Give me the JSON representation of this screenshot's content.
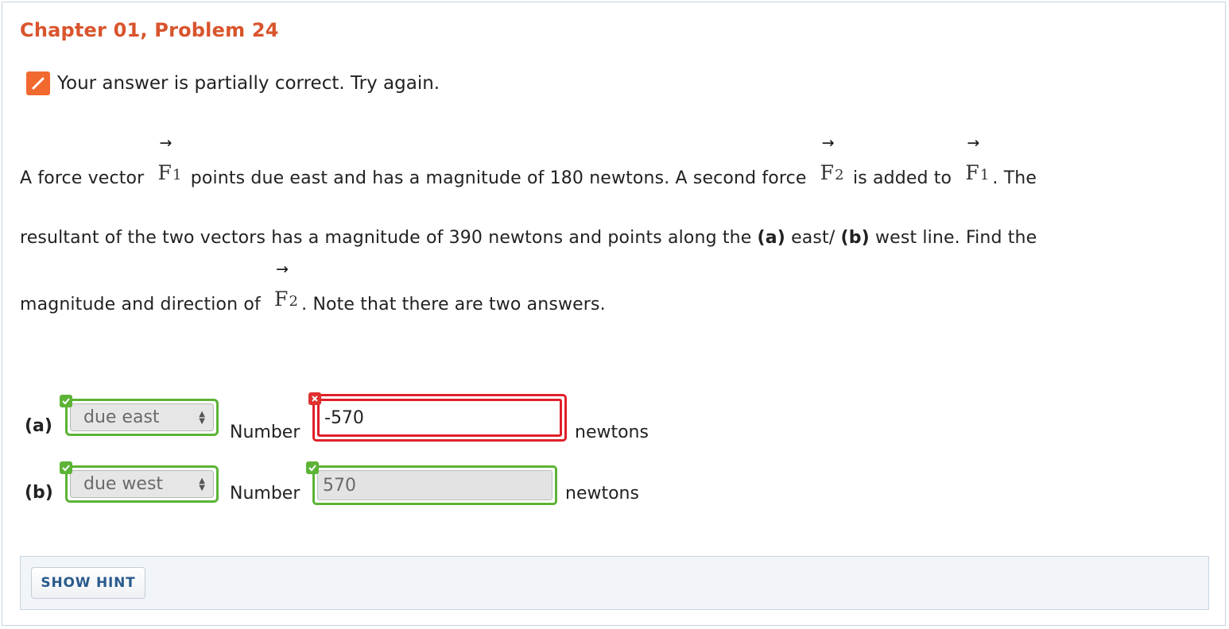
{
  "header": {
    "title": "Chapter 01, Problem 24"
  },
  "status": {
    "message": "Your answer is partially correct.  Try again.",
    "icon": "pencil-icon",
    "color": "#f2692f"
  },
  "problem": {
    "line1": {
      "a": "A force vector",
      "b": "points due east and has a magnitude of 180 newtons. A second force",
      "c": "is added to",
      "d": ". The"
    },
    "line2": {
      "a": "resultant of the two vectors has a magnitude of 390 newtons and points along the",
      "pa": "(a)",
      "b": "east/",
      "pb": "(b)",
      "c": "west line. Find the"
    },
    "line3": {
      "a": "magnitude and direction of",
      "b": ". Note that there are two answers."
    },
    "vectors": {
      "f1": "F",
      "f1_sub": "1",
      "f2": "F",
      "f2_sub": "2",
      "arrow": "→"
    }
  },
  "answers": {
    "a": {
      "label": "(a)",
      "direction": "due east",
      "number_label": "Number",
      "value": "-570",
      "unit": "newtons",
      "direction_status": "correct",
      "value_status": "incorrect"
    },
    "b": {
      "label": "(b)",
      "direction": "due west",
      "number_label": "Number",
      "value": "570",
      "unit": "newtons",
      "direction_status": "correct",
      "value_status": "correct"
    }
  },
  "colors": {
    "title": "#d9542c",
    "correct": "#5cb336",
    "incorrect": "#e0202a",
    "hint_text": "#2a5a8c"
  },
  "hint": {
    "button_label": "SHOW HINT"
  }
}
